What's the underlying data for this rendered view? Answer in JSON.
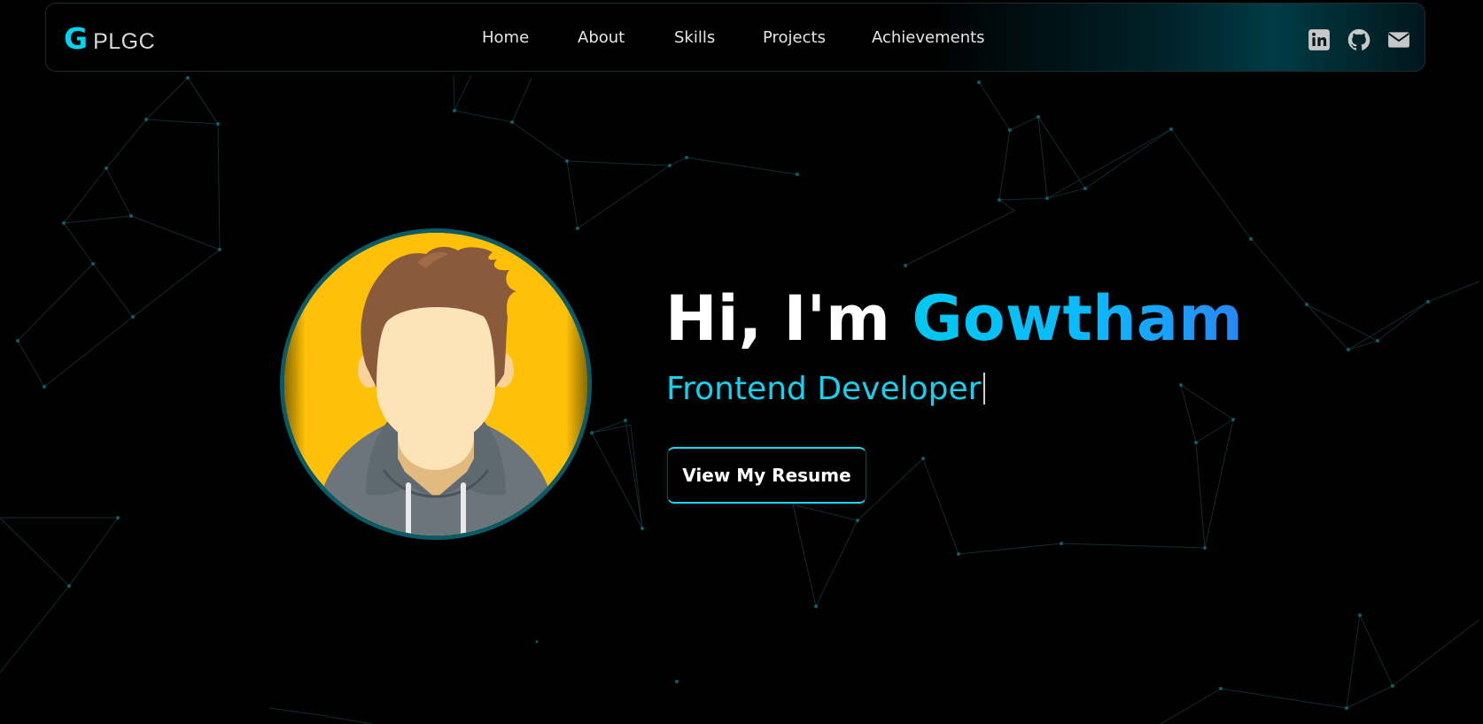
{
  "brand": {
    "mark": "G",
    "text": "PLGC",
    "accent_color": "#00d3ee"
  },
  "nav": {
    "items": [
      {
        "label": "Home"
      },
      {
        "label": "About"
      },
      {
        "label": "Skills"
      },
      {
        "label": "Projects"
      },
      {
        "label": "Achievements"
      }
    ]
  },
  "social": [
    {
      "icon": "linkedin-icon"
    },
    {
      "icon": "github-icon"
    },
    {
      "icon": "mail-icon"
    }
  ],
  "hero": {
    "greeting": "Hi, I'm ",
    "name": "Gowtham",
    "role": "Frontend Developer",
    "button_label": "View My Resume",
    "avatar_icon": "user-avatar-illustration",
    "avatar_background_color": "#ffc107"
  },
  "theme": {
    "background": "#000000",
    "accent": "#00c8f0",
    "name_gradient_end": "#2a86f2"
  }
}
